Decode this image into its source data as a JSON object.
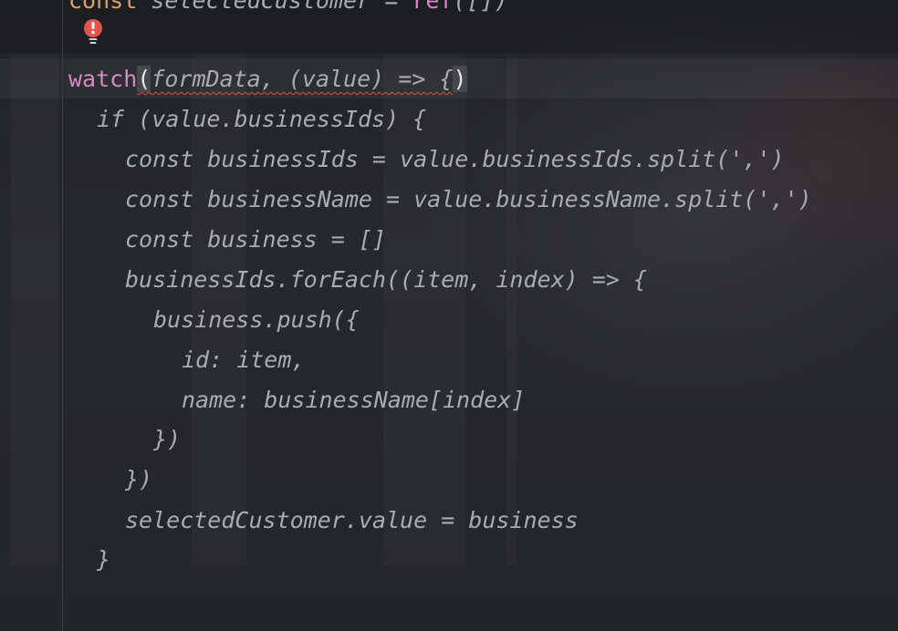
{
  "editor": {
    "lines": {
      "l0": {
        "kw": "const",
        "rest": " selectedCustomer = ",
        "call": "ref",
        "tail": "([])"
      },
      "l1": {
        "fn": "watch",
        "open": "(",
        "args": "formData, (value) => {",
        "close": ")"
      },
      "l2": "if (value.businessIds) {",
      "l3": "const businessIds = value.businessIds.split(',')",
      "l4": "const businessName = value.businessName.split(',')",
      "l5": "const business = []",
      "l6": "businessIds.forEach((item, index) => {",
      "l7": "business.push({",
      "l8": "id: item,",
      "l9": "name: businessName[index]",
      "l10": "})",
      "l11": "})",
      "l12": "selectedCustomer.value = business",
      "l13": "}"
    },
    "gutter_icon": "lightbulb-error-icon",
    "colors": {
      "background": "#242528",
      "text": "#a8abb0",
      "keyword": "#d48ac4",
      "const_keyword": "#d9a06a",
      "error": "#e5534b"
    }
  }
}
